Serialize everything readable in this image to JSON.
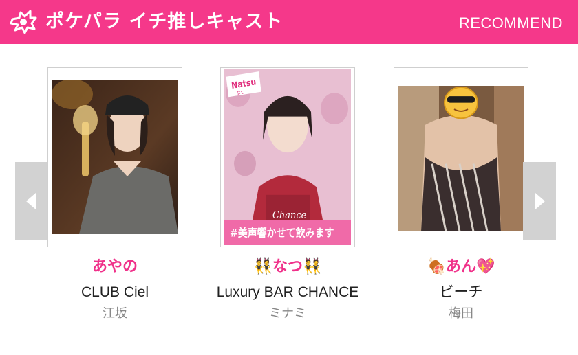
{
  "header": {
    "title": "ポケパラ イチ推しキャスト",
    "link_label": "RECOMMEND",
    "icon": "star-badge-icon",
    "color": "#f5388a"
  },
  "nav": {
    "prev_icon": "chevron-left-icon",
    "next_icon": "chevron-right-icon"
  },
  "casts": [
    {
      "name": "あやの",
      "shop": "CLUB Ciel",
      "area": "江坂"
    },
    {
      "name": "👯なつ👯",
      "shop": "Luxury BAR CHANCE",
      "area": "ミナミ",
      "photo_texts": {
        "tag": "Natsu",
        "tag_sub": "なつ",
        "logo": "Chance",
        "caption": "#美声響かせて飲みます"
      }
    },
    {
      "name": "🍖あん💖",
      "shop": "ビーチ",
      "area": "梅田"
    }
  ],
  "accent_pink": "#f0318a"
}
